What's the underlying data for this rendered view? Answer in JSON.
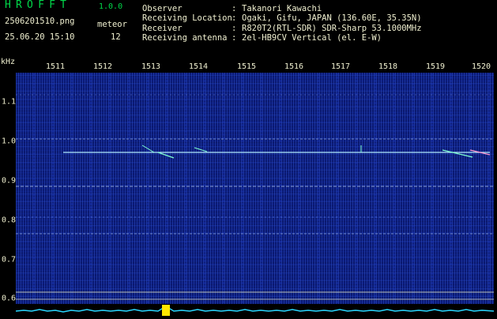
{
  "header": {
    "app_title": "HROFFT",
    "app_version": "1.0.0",
    "file_name": "2506201510.png",
    "timestamp": "25.06.20 15:10",
    "meteor_label": "meteor",
    "meteor_count": "12",
    "info": [
      {
        "key": "Observer",
        "sep": ":",
        "value": "Takanori Kawachi"
      },
      {
        "key": "Receiving Location",
        "sep": ":",
        "value": "Ogaki, Gifu, JAPAN (136.60E, 35.35N)"
      },
      {
        "key": "Receiver",
        "sep": ":",
        "value": "R820T2(RTL-SDR) SDR-Sharp 53.1000MHz"
      },
      {
        "key": "Receiving antenna",
        "sep": ":",
        "value": "2el-HB9CV Vertical (el. E-W)"
      }
    ]
  },
  "axes": {
    "y_unit": "kHz",
    "x_ticks": [
      "1511",
      "1512",
      "1513",
      "1514",
      "1515",
      "1516",
      "1517",
      "1518",
      "1519",
      "1520"
    ],
    "y_ticks": [
      "1.1",
      "1.0",
      "0.9",
      "0.8",
      "0.7",
      "0.6"
    ]
  },
  "colors": {
    "background": "#000000",
    "title_green": "#00d84a",
    "text": "#f0f0d0",
    "spectrum_base": "#0a1a78",
    "carrier": "#aee8ff",
    "meteor_echo": "#7fffd0",
    "power_trace": "#29d6ff",
    "power_peak": "#ffe600",
    "reference_line": "#ffffc0"
  }
}
